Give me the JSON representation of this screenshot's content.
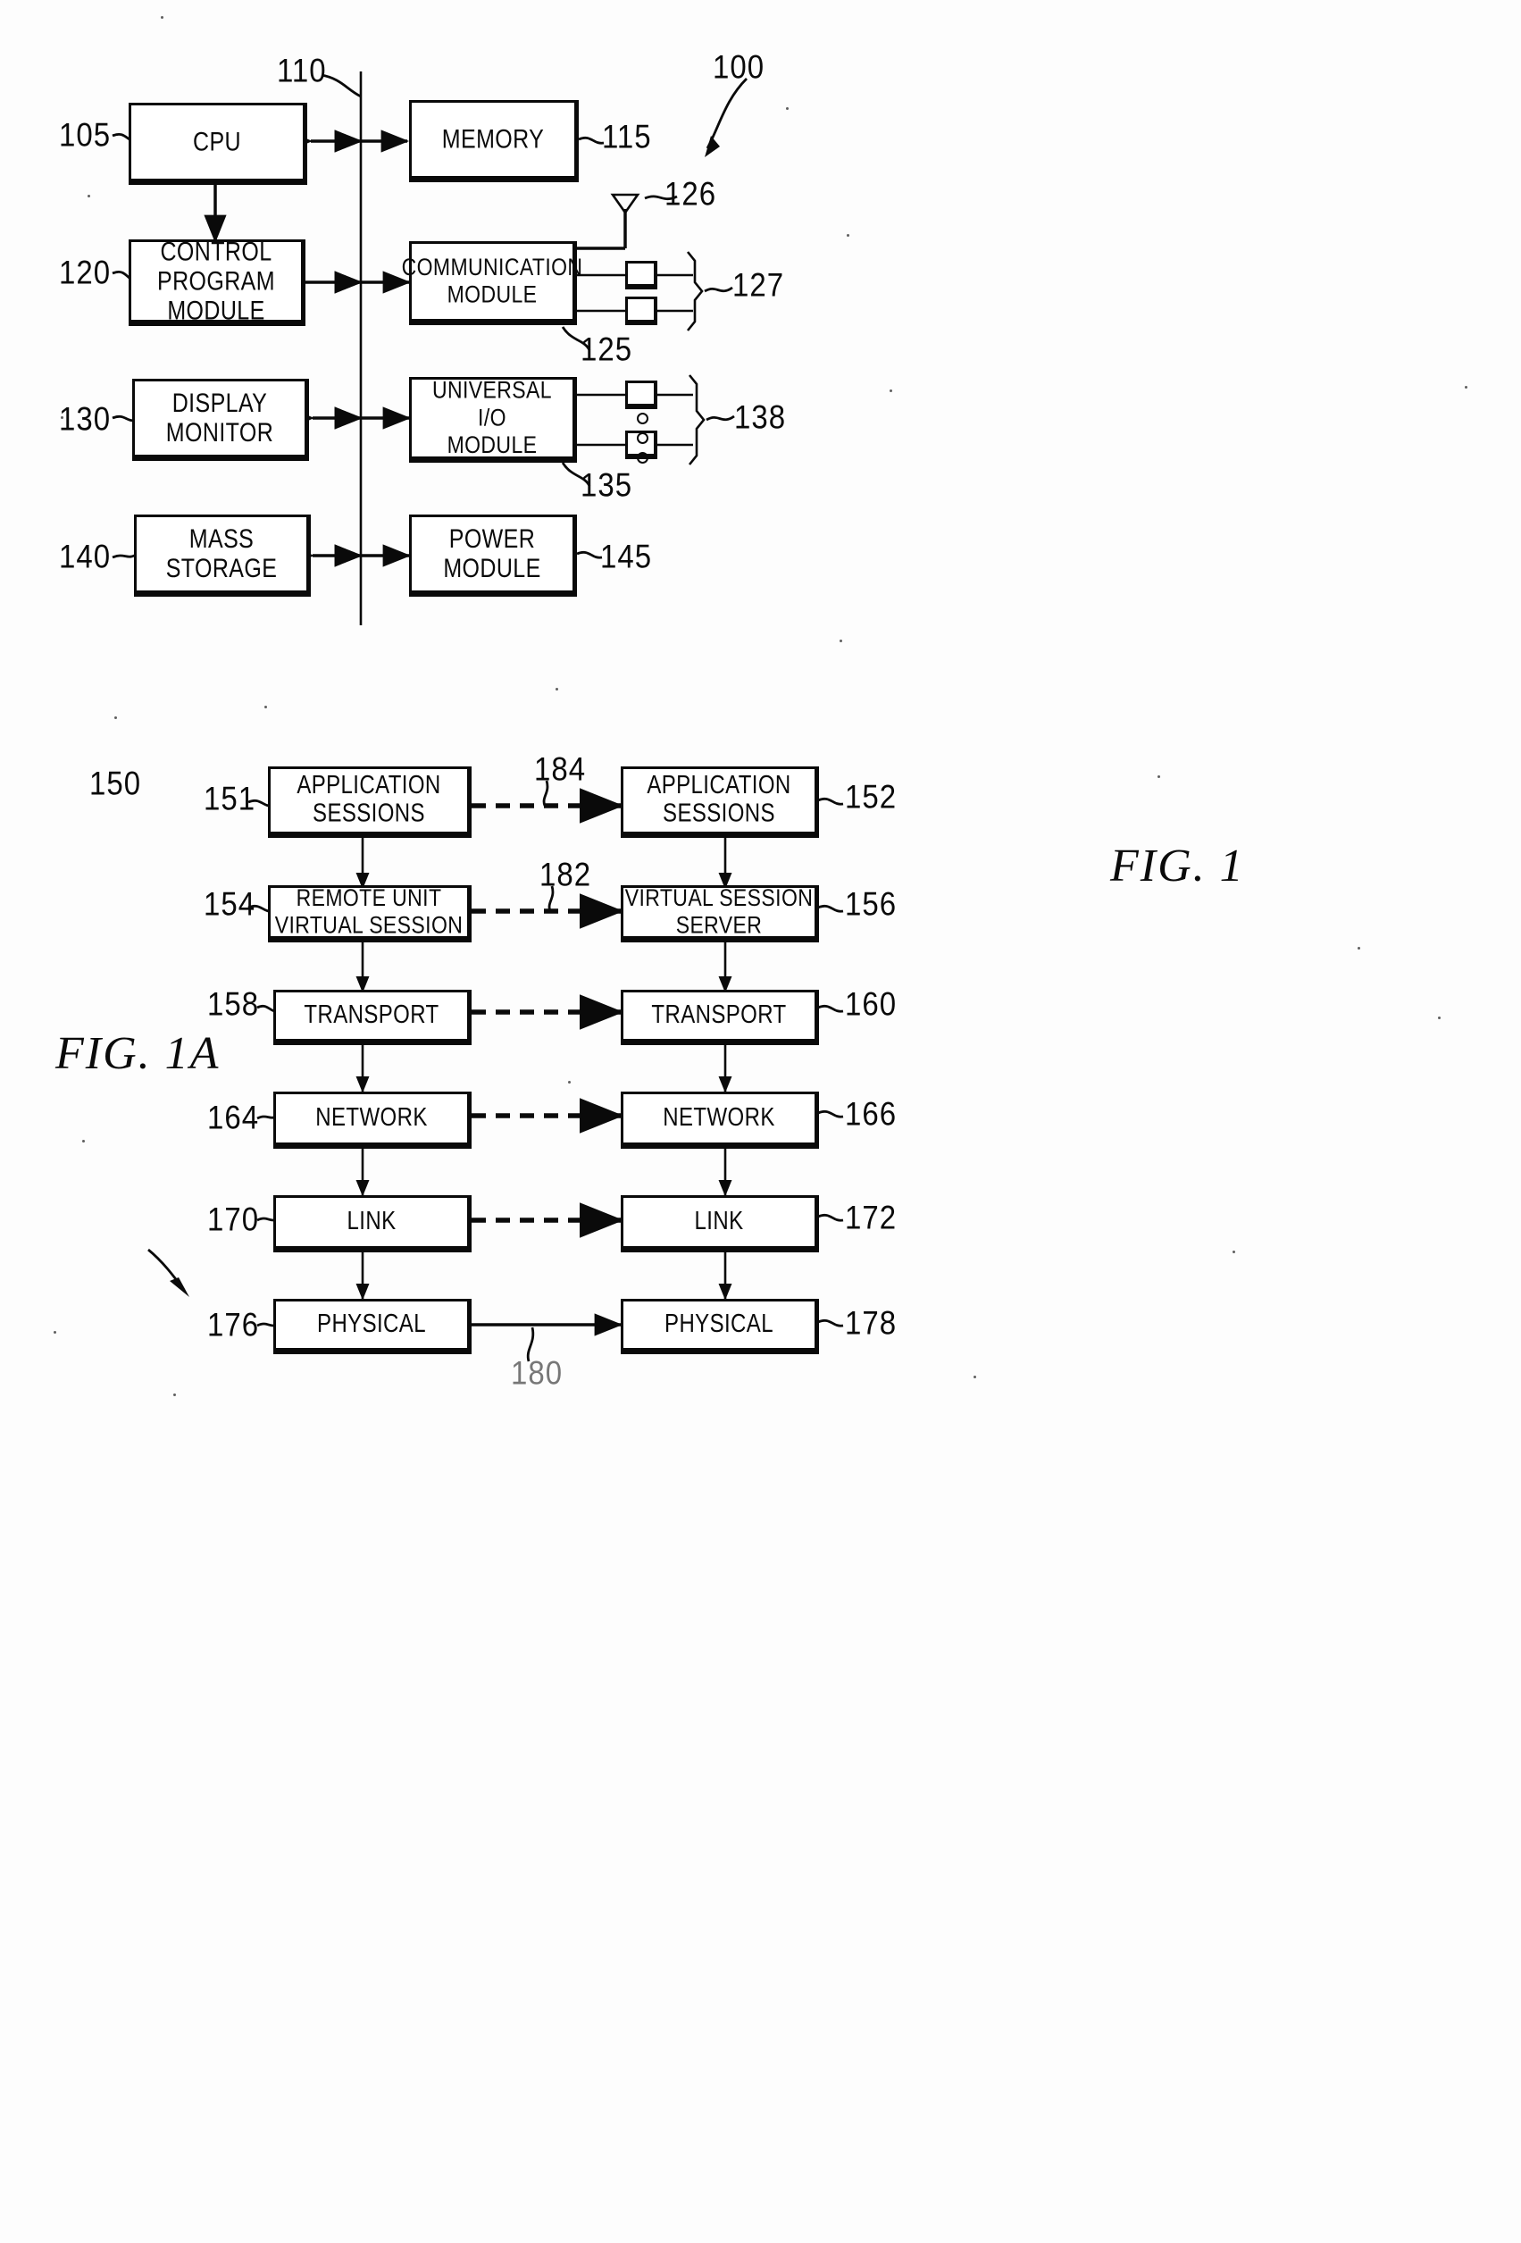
{
  "document": {
    "type": "patent-drawing-sheet",
    "background_color": "#fdfdfd",
    "ink_color": "#0a0a0a"
  },
  "fig1": {
    "caption": "FIG.  1",
    "system_ref": "100",
    "bus_ref": "110",
    "blocks": [
      {
        "id": "cpu",
        "label": "CPU",
        "ref": "105",
        "ref_side": "left"
      },
      {
        "id": "memory",
        "label": "MEMORY",
        "ref": "115",
        "ref_side": "right"
      },
      {
        "id": "control",
        "label": "CONTROL\nPROGRAM\nMODULE",
        "ref": "120",
        "ref_side": "left"
      },
      {
        "id": "communication",
        "label": "COMMUNICATION\nMODULE",
        "ref": "125",
        "ref_side": "below"
      },
      {
        "id": "display",
        "label": "DISPLAY\nMONITOR",
        "ref": "130",
        "ref_side": "left"
      },
      {
        "id": "universalio",
        "label": "UNIVERSAL\nI/O\nMODULE",
        "ref": "135",
        "ref_side": "below"
      },
      {
        "id": "massstorage",
        "label": "MASS\nSTORAGE",
        "ref": "140",
        "ref_side": "left"
      },
      {
        "id": "power",
        "label": "POWER\nMODULE",
        "ref": "145",
        "ref_side": "right"
      }
    ],
    "antenna_ref": "126",
    "comm_ports_ref": "127",
    "io_ports_ref": "138"
  },
  "fig1a": {
    "caption": "FIG.  1A",
    "system_ref": "150",
    "bottom_ref": "180",
    "left_column": [
      {
        "label": "APPLICATION\nSESSIONS",
        "ref": "151"
      },
      {
        "label": "REMOTE UNIT\nVIRTUAL SESSION",
        "ref": "154"
      },
      {
        "label": "TRANSPORT",
        "ref": "158"
      },
      {
        "label": "NETWORK",
        "ref": "164"
      },
      {
        "label": "LINK",
        "ref": "170"
      },
      {
        "label": "PHYSICAL",
        "ref": "176"
      }
    ],
    "right_column": [
      {
        "label": "APPLICATION\nSESSIONS",
        "ref": "152"
      },
      {
        "label": "VIRTUAL SESSION\nSERVER",
        "ref": "156"
      },
      {
        "label": "TRANSPORT",
        "ref": "160"
      },
      {
        "label": "NETWORK",
        "ref": "166"
      },
      {
        "label": "LINK",
        "ref": "172"
      },
      {
        "label": "PHYSICAL",
        "ref": "178"
      }
    ],
    "link_refs": [
      {
        "ref": "184",
        "between": "application-sessions"
      },
      {
        "ref": "182",
        "between": "virtual-session"
      }
    ]
  }
}
